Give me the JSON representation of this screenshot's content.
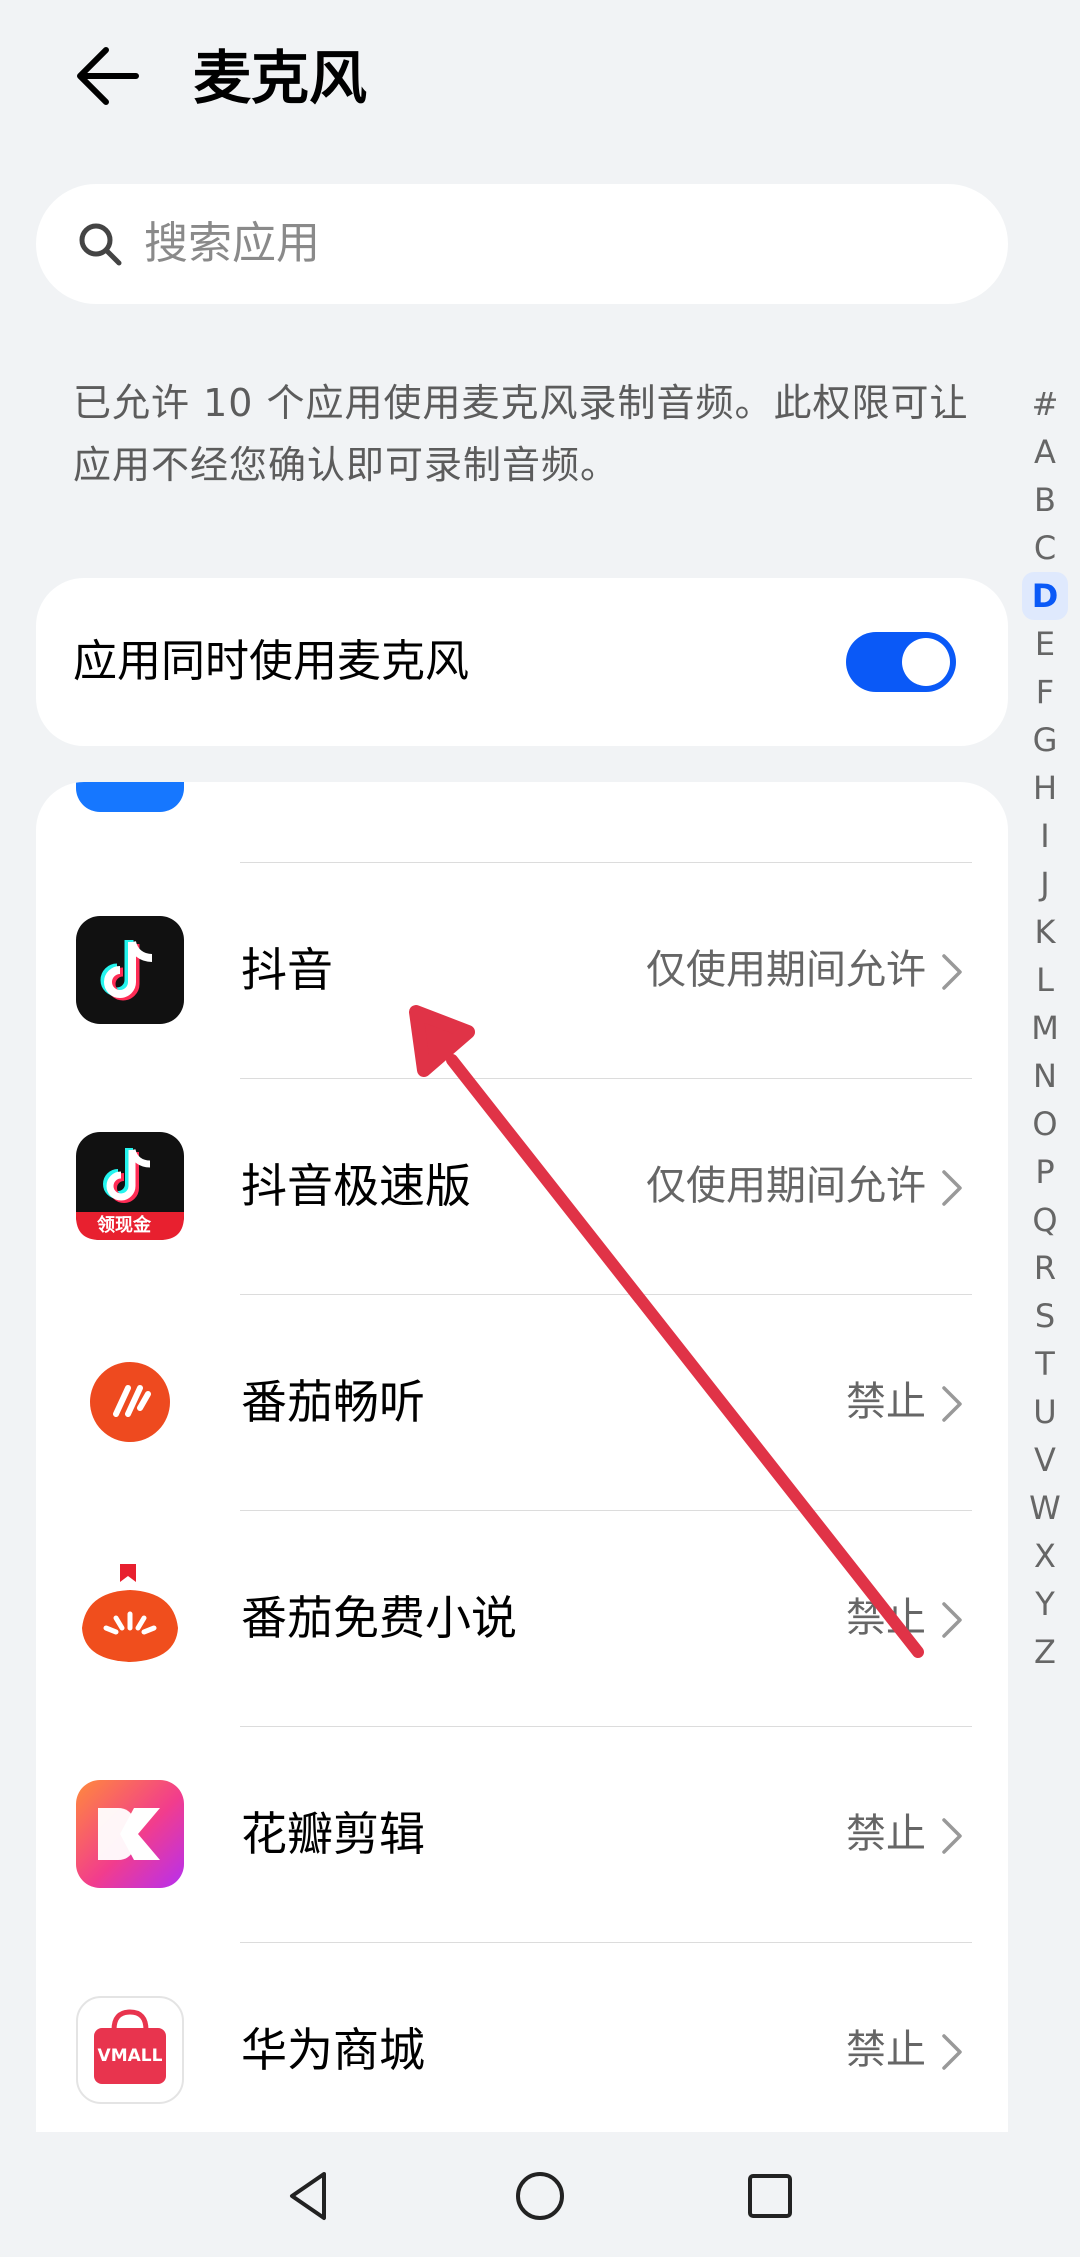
{
  "header": {
    "title": "麦克风"
  },
  "search": {
    "placeholder": "搜索应用"
  },
  "description": "已允许 10 个应用使用麦克风录制音频。此权限可让应用不经您确认即可录制音频。",
  "toggle_card": {
    "label": "应用同时使用麦克风",
    "enabled": true
  },
  "apps": [
    {
      "name": "抖音",
      "status": "仅使用期间允许",
      "icon": "douyin-icon"
    },
    {
      "name": "抖音极速版",
      "status": "仅使用期间允许",
      "icon": "douyin-lite-icon",
      "badge": "领现金"
    },
    {
      "name": "番茄畅听",
      "status": "禁止",
      "icon": "fanqie-listen-icon"
    },
    {
      "name": "番茄免费小说",
      "status": "禁止",
      "icon": "fanqie-novel-icon"
    },
    {
      "name": "花瓣剪辑",
      "status": "禁止",
      "icon": "petal-clip-icon"
    },
    {
      "name": "华为商城",
      "status": "禁止",
      "icon": "vmall-icon",
      "icon_text": "VMALL"
    }
  ],
  "alpha_index": [
    "#",
    "A",
    "B",
    "C",
    "D",
    "E",
    "F",
    "G",
    "H",
    "I",
    "J",
    "K",
    "L",
    "M",
    "N",
    "O",
    "P",
    "Q",
    "R",
    "S",
    "T",
    "U",
    "V",
    "W",
    "X",
    "Y",
    "Z"
  ],
  "alpha_active": "D",
  "colors": {
    "accent": "#0a59f7",
    "annotation_arrow": "#e03347"
  }
}
